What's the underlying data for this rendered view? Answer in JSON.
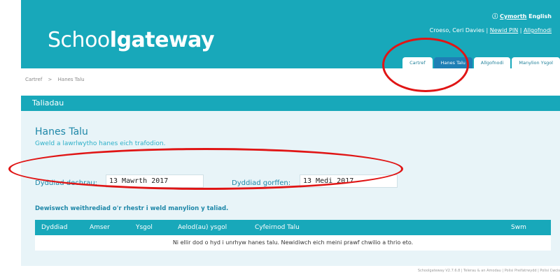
{
  "header": {
    "logo_left": "Sch",
    "logo_oo": "oo",
    "logo_right": "lgateway",
    "help_link": "Cymorth",
    "language": "English",
    "user_text": "Croeso, Ceri Davies",
    "change_pin": "Newid PIN",
    "logout": "Allgofnodi"
  },
  "tabs": [
    {
      "label": "Cartref",
      "active": false
    },
    {
      "label": "Hanes Talu",
      "active": true
    },
    {
      "label": "Allgofnodi",
      "active": false
    },
    {
      "label": "Manylion Ysgol",
      "active": false
    }
  ],
  "breadcrumb": {
    "home": "Cartref",
    "separator": ">",
    "current": "Hanes Talu"
  },
  "section_bar": "Taliadau",
  "page": {
    "title": "Hanes Talu",
    "subtitle": "Gweld a lawrlwytho hanes eich trafodion."
  },
  "dates": {
    "start_label": "Dyddiad dechrau:",
    "start_value": "13 Mawrth 2017",
    "end_label": "Dyddiad gorffen:",
    "end_value": "13 Medi 2017"
  },
  "instruction": "Dewiswch weithrediad o'r rhestr i weld manylion y taliad.",
  "table": {
    "columns": [
      "Dyddiad",
      "Amser",
      "Ysgol",
      "Aelod(au) ysgol",
      "Cyfeirnod Talu",
      "Swm"
    ],
    "empty_message": "Ni ellir dod o hyd i unrhyw hanes talu. Newidiwch eich meini prawf chwilio a thrio eto."
  },
  "footer": "Schoolgateway V2.7.6.8 | Telerau & an Amodau | Polisi Preifatrwydd | Polisi Cwcis",
  "colors": {
    "brand": "#18a8ba",
    "active_tab": "#1e7fb5",
    "panel": "#e8f4f8",
    "annotation": "#e01515"
  }
}
